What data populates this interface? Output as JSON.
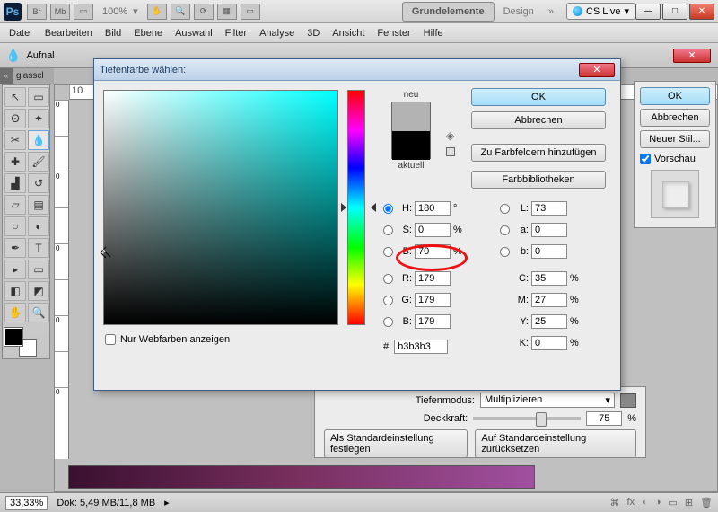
{
  "titlebar": {
    "logo": "Ps",
    "zoom": "100%",
    "tab_grundelemente": "Grundelemente",
    "tab_design": "Design",
    "chevrons": "»",
    "cslive": "CS Live"
  },
  "menu": [
    "Datei",
    "Bearbeiten",
    "Bild",
    "Ebene",
    "Auswahl",
    "Filter",
    "Analyse",
    "3D",
    "Ansicht",
    "Fenster",
    "Hilfe"
  ],
  "optbar": {
    "label": "Aufnal"
  },
  "doc_tab": "glasscl",
  "ruler_h": [
    "10"
  ],
  "ruler_v": [
    "0",
    "",
    "0",
    "",
    "0",
    "",
    "0",
    "",
    "0",
    "",
    "0"
  ],
  "side": {
    "ok": "OK",
    "cancel": "Abbrechen",
    "newstyle": "Neuer Stil...",
    "preview": "Vorschau"
  },
  "style_dialog": {
    "tiefenmodus": "Tiefenmodus:",
    "multi": "Multiplizieren",
    "deckkraft": "Deckkraft:",
    "deck_val": "75",
    "deck_unit": "%",
    "btn_std": "Als Standardeinstellung festlegen",
    "btn_reset": "Auf Standardeinstellung zurücksetzen"
  },
  "picker": {
    "title": "Tiefenfarbe wählen:",
    "neu": "neu",
    "aktuell": "aktuell",
    "ok": "OK",
    "cancel": "Abbrechen",
    "add": "Zu Farbfeldern hinzufügen",
    "lib": "Farbbibliotheken",
    "webonly": "Nur Webfarben anzeigen",
    "fields": {
      "H": {
        "label": "H:",
        "val": "180",
        "unit": "°"
      },
      "S": {
        "label": "S:",
        "val": "0",
        "unit": "%"
      },
      "B": {
        "label": "B:",
        "val": "70",
        "unit": "%"
      },
      "R": {
        "label": "R:",
        "val": "179"
      },
      "G": {
        "label": "G:",
        "val": "179"
      },
      "Bl": {
        "label": "B:",
        "val": "179"
      },
      "L": {
        "label": "L:",
        "val": "73"
      },
      "a": {
        "label": "a:",
        "val": "0"
      },
      "b": {
        "label": "b:",
        "val": "0"
      },
      "C": {
        "label": "C:",
        "val": "35",
        "unit": "%"
      },
      "M": {
        "label": "M:",
        "val": "27",
        "unit": "%"
      },
      "Y": {
        "label": "Y:",
        "val": "25",
        "unit": "%"
      },
      "K": {
        "label": "K:",
        "val": "0",
        "unit": "%"
      },
      "hex_label": "#",
      "hex": "b3b3b3"
    }
  },
  "status": {
    "zoom": "33,33%",
    "dok": "Dok: 5,49 MB/11,8 MB"
  }
}
